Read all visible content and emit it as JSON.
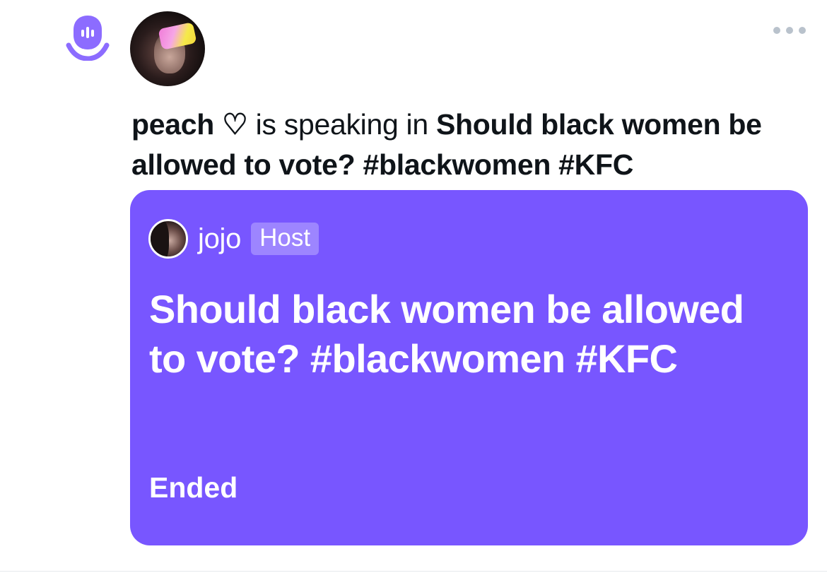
{
  "header": {
    "spaces_icon": "spaces-microphone-face-icon",
    "more_icon": "more-horizontal-icon",
    "accent_color": "#7856ff"
  },
  "activity": {
    "user": "peach ♡",
    "verb": " is speaking in ",
    "space_title": "Should black women be allowed to vote? #blackwomen #KFC"
  },
  "space_card": {
    "host_name": "jojo",
    "host_badge": "Host",
    "title": "Should black women be allowed to vote? #blackwomen #KFC",
    "status": "Ended",
    "background_color": "#7856ff"
  }
}
